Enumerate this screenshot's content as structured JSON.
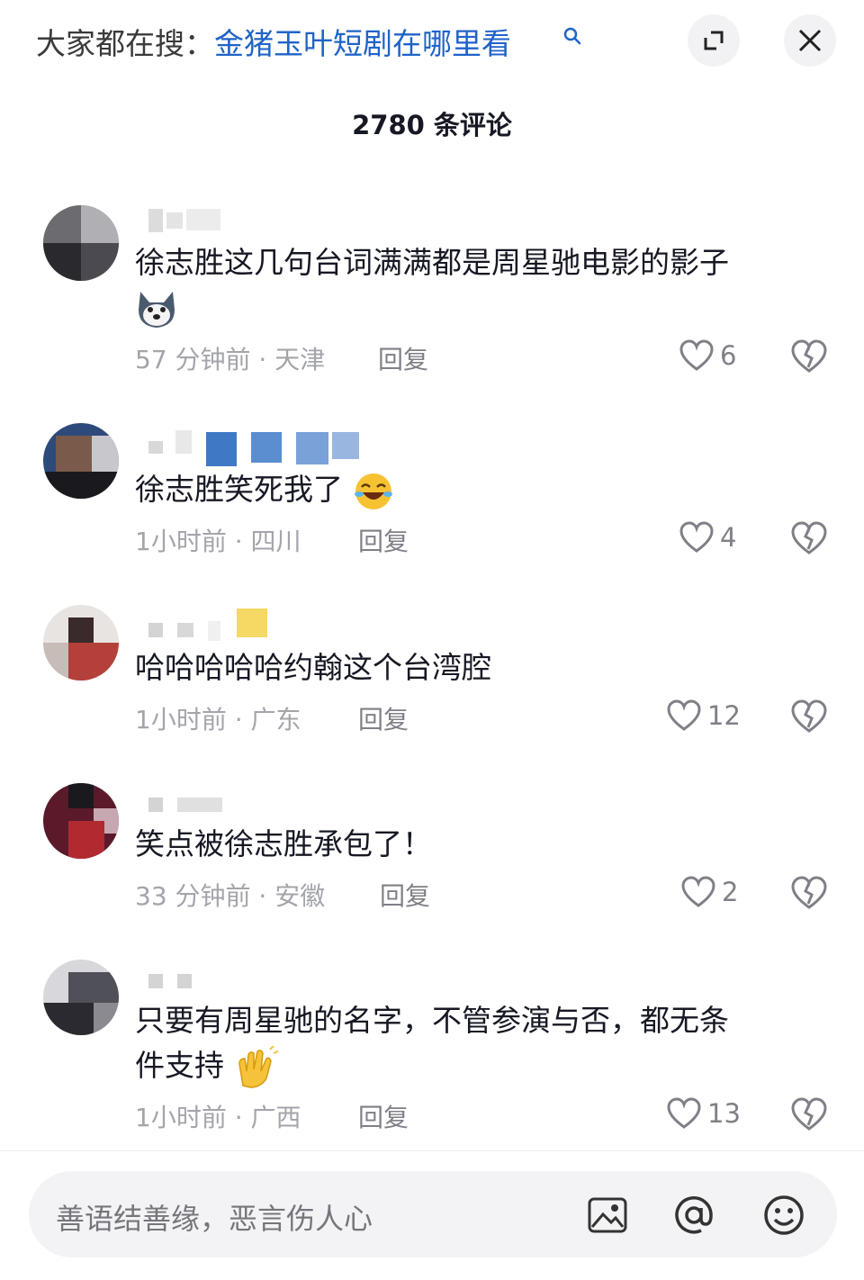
{
  "header": {
    "search_prefix": "大家都在搜：",
    "search_query": "金猪玉叶短剧在哪里看",
    "expand_icon": "collapse-icon",
    "close_icon": "close-icon"
  },
  "comment_count_title": "2780 条评论",
  "comments": [
    {
      "text_line1": "徐志胜这几句台词满满都是周星驰电影的影子",
      "emoji": "husky-dog-emoji",
      "time": "57 分钟前 · 天津",
      "reply_label": "回复",
      "likes": "6"
    },
    {
      "text_line1": "徐志胜笑死我了",
      "emoji": "laughing-emoji",
      "time": "1小时前 · 四川",
      "reply_label": "回复",
      "likes": "4"
    },
    {
      "text_line1": "哈哈哈哈哈约翰这个台湾腔",
      "time": "1小时前 · 广东",
      "reply_label": "回复",
      "likes": "12"
    },
    {
      "text_line1": "笑点被徐志胜承包了！",
      "time": "33 分钟前 · 安徽",
      "reply_label": "回复",
      "likes": "2"
    },
    {
      "text_line1": "只要有周星驰的名字，不管参演与否，都无条",
      "text_line2": "件支持",
      "emoji": "clapping-hands-emoji",
      "time": "1小时前 · 广西",
      "reply_label": "回复",
      "likes": "13"
    }
  ],
  "input": {
    "placeholder": "善语结善缘，恶言伤人心",
    "icons": [
      "image-icon",
      "at-icon",
      "emoji-icon"
    ]
  },
  "colors": {
    "query_blue": "#1f63c8",
    "meta_gray": "#a3a5ab",
    "text_dark": "#161823"
  }
}
